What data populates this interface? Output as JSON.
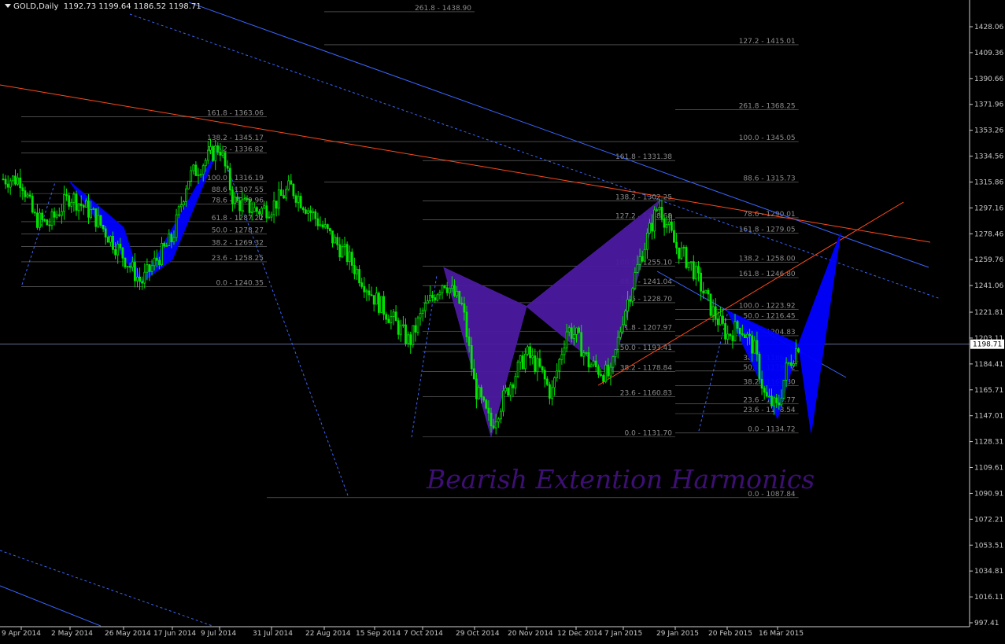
{
  "header": {
    "symbol": "GOLD,Daily",
    "ohlc": "1192.73 1199.64 1186.52 1198.71"
  },
  "watermark": "Bearish Extention Harmonics",
  "colors": {
    "background": "#000000",
    "candle": "#00e600",
    "blue_pattern": "#0000ff",
    "purple_pattern": "#4b1aa0",
    "trend_blue": "#3a66ff",
    "trend_red": "#ff4a1a",
    "fib_line": "#8c8c8c",
    "axis_text": "#c8c8c8",
    "watermark": "#3d0f74"
  },
  "chart_data": {
    "type": "candlestick",
    "title": "GOLD,Daily",
    "ylim": [
      997.41,
      1447.0
    ],
    "current_price": 1198.71,
    "y_ticks": [
      "1428.06",
      "1409.36",
      "1390.66",
      "1371.96",
      "1353.26",
      "1334.56",
      "1315.86",
      "1297.16",
      "1278.46",
      "1259.76",
      "1241.06",
      "1221.81",
      "1203.11",
      "1184.41",
      "1165.71",
      "1147.01",
      "1128.31",
      "1109.61",
      "1090.91",
      "1072.21",
      "1053.51",
      "1034.81",
      "1016.11",
      "997.41"
    ],
    "x_ticks": [
      "9 Apr 2014",
      "2 May 2014",
      "26 May 2014",
      "17 Jun 2014",
      "9 Jul 2014",
      "31 Jul 2014",
      "22 Aug 2014",
      "15 Sep 2014",
      "7 Oct 2014",
      "29 Oct 2014",
      "20 Nov 2014",
      "12 Dec 2014",
      "7 Jan 2015",
      "29 Jan 2015",
      "20 Feb 2015",
      "16 Mar 2015"
    ],
    "price_path": [
      {
        "date": "9 Apr 2014",
        "close": 1318
      },
      {
        "date": "15 Apr 2014",
        "close": 1290
      },
      {
        "date": "22 Apr 2014",
        "close": 1285
      },
      {
        "date": "2 May 2014",
        "close": 1306
      },
      {
        "date": "12 May 2014",
        "close": 1293
      },
      {
        "date": "26 May 2014",
        "close": 1262
      },
      {
        "date": "3 Jun 2014",
        "close": 1243
      },
      {
        "date": "10 Jun 2014",
        "close": 1260
      },
      {
        "date": "17 Jun 2014",
        "close": 1275
      },
      {
        "date": "24 Jun 2014",
        "close": 1318
      },
      {
        "date": "9 Jul 2014",
        "close": 1342
      },
      {
        "date": "15 Jul 2014",
        "close": 1302
      },
      {
        "date": "25 Jul 2014",
        "close": 1295
      },
      {
        "date": "31 Jul 2014",
        "close": 1298
      },
      {
        "date": "8 Aug 2014",
        "close": 1312
      },
      {
        "date": "22 Aug 2014",
        "close": 1282
      },
      {
        "date": "2 Sep 2014",
        "close": 1262
      },
      {
        "date": "15 Sep 2014",
        "close": 1232
      },
      {
        "date": "24 Sep 2014",
        "close": 1215
      },
      {
        "date": "1 Oct 2014",
        "close": 1200
      },
      {
        "date": "7 Oct 2014",
        "close": 1222
      },
      {
        "date": "16 Oct 2014",
        "close": 1245
      },
      {
        "date": "24 Oct 2014",
        "close": 1225
      },
      {
        "date": "29 Oct 2014",
        "close": 1168
      },
      {
        "date": "5 Nov 2014",
        "close": 1140
      },
      {
        "date": "13 Nov 2014",
        "close": 1170
      },
      {
        "date": "20 Nov 2014",
        "close": 1192
      },
      {
        "date": "26 Nov 2014",
        "close": 1180
      },
      {
        "date": "1 Dec 2014",
        "close": 1162
      },
      {
        "date": "8 Dec 2014",
        "close": 1210
      },
      {
        "date": "12 Dec 2014",
        "close": 1205
      },
      {
        "date": "19 Dec 2014",
        "close": 1185
      },
      {
        "date": "31 Dec 2014",
        "close": 1175
      },
      {
        "date": "7 Jan 2015",
        "close": 1220
      },
      {
        "date": "14 Jan 2015",
        "close": 1260
      },
      {
        "date": "22 Jan 2015",
        "close": 1300
      },
      {
        "date": "29 Jan 2015",
        "close": 1270
      },
      {
        "date": "5 Feb 2015",
        "close": 1255
      },
      {
        "date": "13 Feb 2015",
        "close": 1225
      },
      {
        "date": "20 Feb 2015",
        "close": 1205
      },
      {
        "date": "26 Feb 2015",
        "close": 1212
      },
      {
        "date": "5 Mar 2015",
        "close": 1195
      },
      {
        "date": "10 Mar 2015",
        "close": 1160
      },
      {
        "date": "16 Mar 2015",
        "close": 1152
      },
      {
        "date": "20 Mar 2015",
        "close": 1180
      },
      {
        "date": "26 Mar 2015",
        "close": 1198.71
      }
    ],
    "fib_annotations": [
      {
        "text": "261.8 - 1438.90",
        "price": 1438.9,
        "from": "22 Aug 2014",
        "to": "29 Oct 2014"
      },
      {
        "text": "161.8 - 1363.06",
        "price": 1363.06,
        "from": "9 Apr 2014",
        "to": "29 Jul 2014"
      },
      {
        "text": "138.2 - 1345.17",
        "price": 1345.17,
        "from": "9 Apr 2014",
        "to": "29 Jul 2014"
      },
      {
        "text": "127.2 - 1336.82",
        "price": 1336.82,
        "from": "9 Apr 2014",
        "to": "29 Jul 2014"
      },
      {
        "text": "100.0 - 1316.19",
        "price": 1316.19,
        "from": "9 Apr 2014",
        "to": "29 Jul 2014"
      },
      {
        "text": "88.6 - 1307.55",
        "price": 1307.55,
        "from": "9 Apr 2014",
        "to": "29 Jul 2014"
      },
      {
        "text": "78.6 - 1299.96",
        "price": 1299.96,
        "from": "9 Apr 2014",
        "to": "29 Jul 2014"
      },
      {
        "text": "61.8 - 1287.22",
        "price": 1287.22,
        "from": "9 Apr 2014",
        "to": "29 Jul 2014"
      },
      {
        "text": "50.0 - 1278.27",
        "price": 1278.27,
        "from": "9 Apr 2014",
        "to": "29 Jul 2014"
      },
      {
        "text": "38.2 - 1269.32",
        "price": 1269.32,
        "from": "9 Apr 2014",
        "to": "29 Jul 2014"
      },
      {
        "text": "23.6 - 1258.25",
        "price": 1258.25,
        "from": "9 Apr 2014",
        "to": "29 Jul 2014"
      },
      {
        "text": "0.0 - 1240.35",
        "price": 1240.35,
        "from": "9 Apr 2014",
        "to": "29 Jul 2014"
      },
      {
        "text": "161.8 - 1331.38",
        "price": 1331.38,
        "from": "7 Oct 2014",
        "to": "29 Jan 2015"
      },
      {
        "text": "138.2 - 1302.25",
        "price": 1302.25,
        "from": "7 Oct 2014",
        "to": "29 Jan 2015"
      },
      {
        "text": "127.2 - 1288.68",
        "price": 1288.68,
        "from": "7 Oct 2014",
        "to": "29 Jan 2015"
      },
      {
        "text": "100.0 - 1255.10",
        "price": 1255.1,
        "from": "7 Oct 2014",
        "to": "29 Jan 2015"
      },
      {
        "text": "88.6 - 1241.04",
        "price": 1241.04,
        "from": "7 Oct 2014",
        "to": "29 Jan 2015"
      },
      {
        "text": "78.6 - 1228.70",
        "price": 1228.7,
        "from": "7 Oct 2014",
        "to": "29 Jan 2015"
      },
      {
        "text": "61.8 - 1207.97",
        "price": 1207.97,
        "from": "7 Oct 2014",
        "to": "29 Jan 2015"
      },
      {
        "text": "50.0 - 1193.41",
        "price": 1193.41,
        "from": "7 Oct 2014",
        "to": "29 Jan 2015"
      },
      {
        "text": "38.2 - 1178.84",
        "price": 1178.84,
        "from": "7 Oct 2014",
        "to": "29 Jan 2015"
      },
      {
        "text": "23.6 - 1160.83",
        "price": 1160.83,
        "from": "7 Oct 2014",
        "to": "29 Jan 2015"
      },
      {
        "text": "0.0 - 1131.70",
        "price": 1131.7,
        "from": "7 Oct 2014",
        "to": "29 Jan 2015"
      },
      {
        "text": "0.0 - 1087.84",
        "price": 1087.84,
        "from": "29 Jul 2014",
        "to": "26 Mar 2015"
      },
      {
        "text": "127.2 - 1415.01",
        "price": 1415.01,
        "from": "22 Aug 2014",
        "to": "26 Mar 2015"
      },
      {
        "text": "261.8 - 1368.25",
        "price": 1368.25,
        "from": "29 Jan 2015",
        "to": "26 Mar 2015"
      },
      {
        "text": "100.0 - 1345.05",
        "price": 1345.05,
        "from": "22 Aug 2014",
        "to": "26 Mar 2015"
      },
      {
        "text": "88.6 - 1315.73",
        "price": 1315.73,
        "from": "22 Aug 2014",
        "to": "26 Mar 2015"
      },
      {
        "text": "78.6 - 1290.01",
        "price": 1290.01,
        "from": "29 Jan 2015",
        "to": "26 Mar 2015"
      },
      {
        "text": "161.8 - 1279.05",
        "price": 1279.05,
        "from": "29 Jan 2015",
        "to": "26 Mar 2015"
      },
      {
        "text": "138.2 - 1258.00",
        "price": 1258.0,
        "from": "29 Jan 2015",
        "to": "26 Mar 2015"
      },
      {
        "text": "161.8 - 1246.80",
        "price": 1246.8,
        "from": "29 Jan 2015",
        "to": "26 Mar 2015"
      },
      {
        "text": "100.0 - 1223.92",
        "price": 1223.92,
        "from": "29 Jan 2015",
        "to": "26 Mar 2015"
      },
      {
        "text": "50.0 - 1216.45",
        "price": 1216.45,
        "from": "29 Jan 2015",
        "to": "26 Mar 2015"
      },
      {
        "text": "78.6 - 1204.83",
        "price": 1204.83,
        "from": "29 Jan 2015",
        "to": "26 Mar 2015"
      },
      {
        "text": "38.2 - 1186.10",
        "price": 1186.1,
        "from": "29 Jan 2015",
        "to": "26 Mar 2015"
      },
      {
        "text": "50.0 - 1179.32",
        "price": 1179.32,
        "from": "29 Jan 2015",
        "to": "26 Mar 2015"
      },
      {
        "text": "38.2 - 1168.80",
        "price": 1168.8,
        "from": "29 Jan 2015",
        "to": "26 Mar 2015"
      },
      {
        "text": "23.6 - 1155.77",
        "price": 1155.77,
        "from": "29 Jan 2015",
        "to": "26 Mar 2015"
      },
      {
        "text": "23.6 - 1148.54",
        "price": 1148.54,
        "from": "29 Jan 2015",
        "to": "26 Mar 2015"
      },
      {
        "text": "0.0 - 1134.72",
        "price": 1134.72,
        "from": "29 Jan 2015",
        "to": "26 Mar 2015"
      }
    ],
    "patterns": [
      {
        "name": "blue-bat-1",
        "color": "#0000ff",
        "points": [
          {
            "date": "2 May 2014",
            "price": 1316
          },
          {
            "date": "26 May 2014",
            "price": 1283
          },
          {
            "date": "3 Jun 2014",
            "price": 1243
          },
          {
            "date": "17 Jun 2014",
            "price": 1260
          },
          {
            "date": "9 Jul 2014",
            "price": 1342
          }
        ]
      },
      {
        "name": "purple-crab",
        "color": "#4b1aa0",
        "points": [
          {
            "date": "16 Oct 2014",
            "price": 1254
          },
          {
            "date": "5 Nov 2014",
            "price": 1132
          },
          {
            "date": "20 Nov 2014",
            "price": 1226
          },
          {
            "date": "31 Dec 2014",
            "price": 1176
          },
          {
            "date": "22 Jan 2015",
            "price": 1302
          }
        ]
      },
      {
        "name": "blue-bat-2",
        "color": "#0000ff",
        "points": [
          {
            "date": "20 Feb 2015",
            "price": 1223
          },
          {
            "date": "16 Mar 2015",
            "price": 1145
          },
          {
            "date": "26 Mar 2015",
            "price": 1198.71
          },
          {
            "date": "1 Apr 2015",
            "price": 1134.7
          },
          {
            "date": "15 Apr 2015",
            "price": 1279
          }
        ]
      }
    ]
  }
}
